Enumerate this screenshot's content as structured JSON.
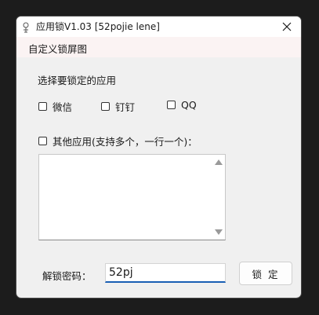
{
  "window": {
    "title": "应用锁V1.03 [52pojie lene]",
    "icon": "lock-app-icon"
  },
  "menu": {
    "items": [
      "自定义锁屏图"
    ]
  },
  "main": {
    "section_label": "选择要锁定的应用",
    "apps": [
      {
        "label": "微信",
        "checked": false
      },
      {
        "label": "钉钉",
        "checked": false
      },
      {
        "label": "QQ",
        "checked": false
      }
    ],
    "other_apps": {
      "label": "其他应用(支持多个，一行一个)：",
      "checked": false,
      "textarea_value": ""
    },
    "password": {
      "label": "解锁密码：",
      "value": "52pj"
    },
    "lock_button": "锁 定"
  },
  "colors": {
    "accent": "#1a5fb4",
    "background": "#f0f0f0",
    "menubar": "#fbf3f3"
  }
}
